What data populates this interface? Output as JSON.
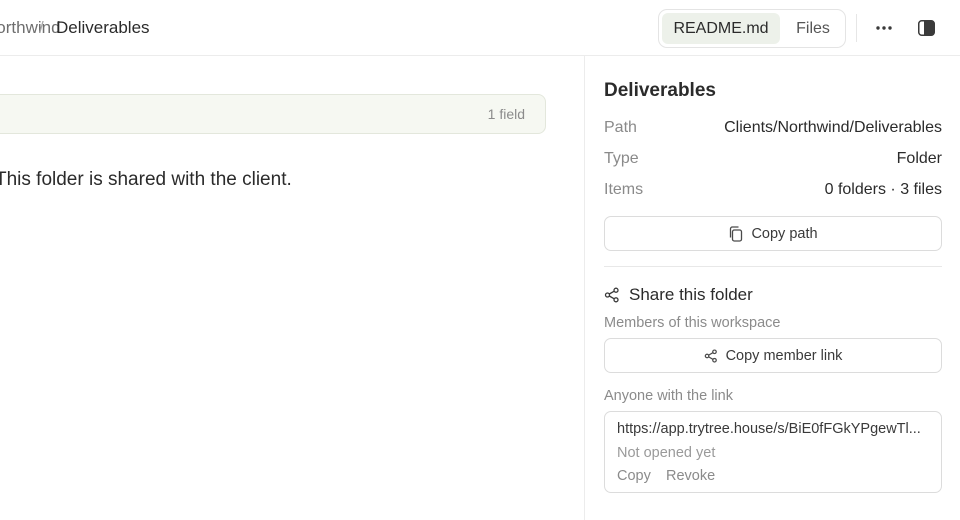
{
  "breadcrumb": {
    "previous": "Northwind",
    "separator": "/",
    "current": "Deliverables"
  },
  "view_toggle": {
    "readme_label": "README.md",
    "files_label": "Files",
    "active": "README.md"
  },
  "toolbar": {
    "more_icon": "ellipsis-icon",
    "panel_icon": "sidebar-toggle-icon"
  },
  "main": {
    "field_count": "1 field",
    "body_text": "This folder is shared with the client."
  },
  "sidebar": {
    "title": "Deliverables",
    "meta": [
      {
        "label": "Path",
        "value": "Clients/Northwind/Deliverables"
      },
      {
        "label": "Type",
        "value": "Folder"
      },
      {
        "label": "Items",
        "value": "0 folders · 3 files"
      }
    ],
    "copy_path_label": "Copy path",
    "share": {
      "title": "Share this folder",
      "members_label": "Members of this workspace",
      "copy_member_link_label": "Copy member link",
      "anyone_label": "Anyone with the link",
      "link_url": "https://app.trytree.house/s/BiE0fFGkYPgewTl...",
      "link_status": "Not opened yet",
      "copy_label": "Copy",
      "revoke_label": "Revoke"
    }
  },
  "colors": {
    "active_tab_bg": "#edf1ea",
    "field_bar_bg": "#f6f8f2",
    "border": "#dcdcdc",
    "muted_text": "#8b8b8b"
  }
}
